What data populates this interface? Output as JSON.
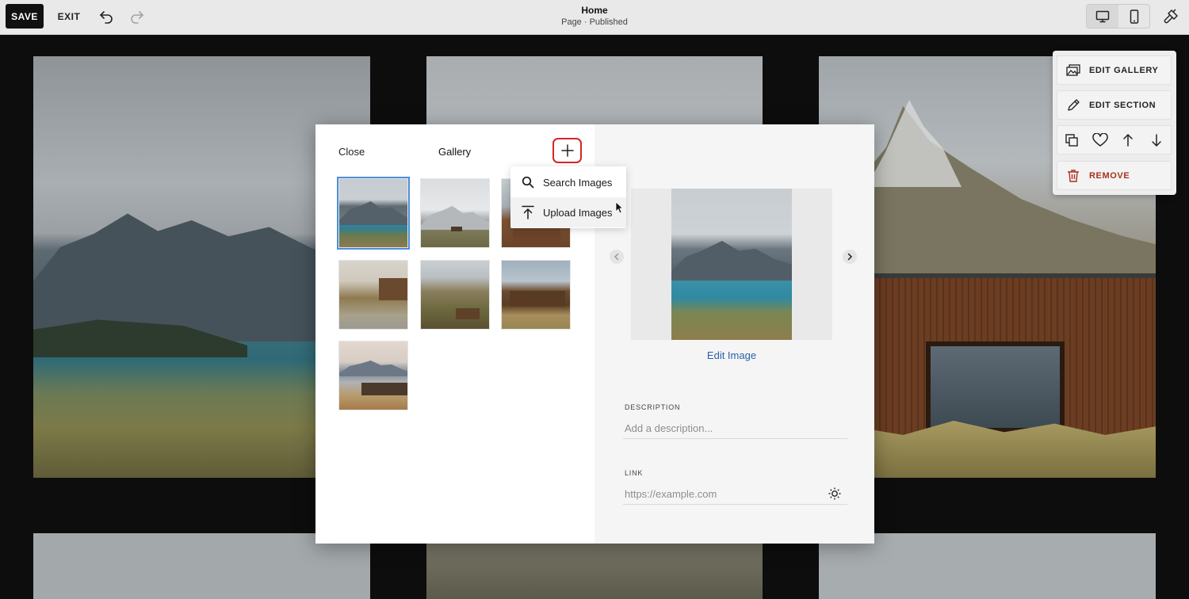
{
  "toolbar": {
    "save_label": "SAVE",
    "exit_label": "EXIT",
    "page_title": "Home",
    "page_status": "Page · Published"
  },
  "section_menu": {
    "edit_gallery_label": "EDIT GALLERY",
    "edit_section_label": "EDIT SECTION",
    "remove_label": "REMOVE"
  },
  "modal": {
    "close_label": "Close",
    "title": "Gallery",
    "add_menu": {
      "search_label": "Search Images",
      "upload_label": "Upload Images"
    },
    "edit_image_label": "Edit Image",
    "description": {
      "label": "DESCRIPTION",
      "value": "",
      "placeholder": "Add a description..."
    },
    "link": {
      "label": "LINK",
      "value": "",
      "placeholder": "https://example.com"
    }
  },
  "colors": {
    "accent_link": "#2a62a8",
    "selected_outline": "#4b8fd9",
    "add_highlight": "#d62626",
    "remove_red": "#a8321c"
  }
}
